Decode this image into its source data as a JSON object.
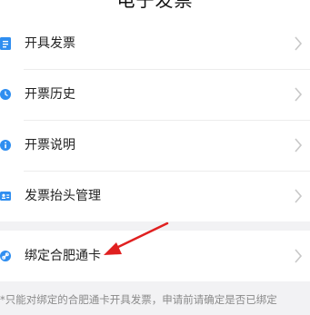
{
  "header": {
    "title": "电子发票"
  },
  "menu": [
    {
      "label": "开具发票",
      "icon": "invoice-icon"
    },
    {
      "label": "开票历史",
      "icon": "clock-icon"
    },
    {
      "label": "开票说明",
      "icon": "info-icon"
    },
    {
      "label": "发票抬头管理",
      "icon": "id-card-icon"
    }
  ],
  "bind_card": {
    "label": "绑定合肥通卡",
    "icon": "link-icon"
  },
  "notice": {
    "text": "*只能对绑定的合肥通卡开具发票，申请前请确定是否已绑定"
  },
  "colors": {
    "accent": "#2f8ef0",
    "annotation_arrow": "#e02020",
    "background": "#f2f2f4"
  }
}
